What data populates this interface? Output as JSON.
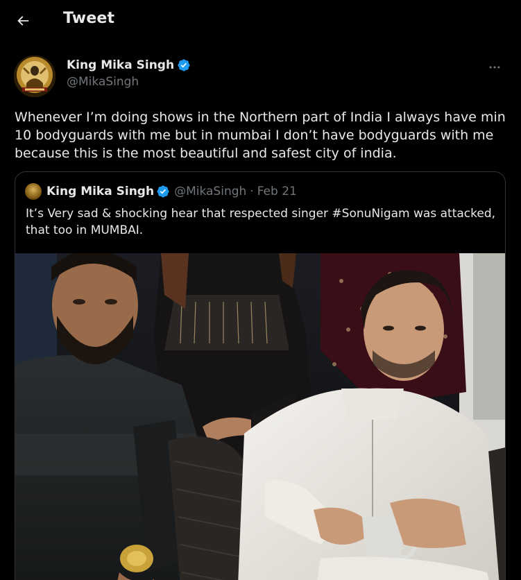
{
  "header": {
    "title": "Tweet",
    "back_icon": "arrow-left-icon"
  },
  "tweet": {
    "author": {
      "display_name": "King Mika Singh",
      "handle": "@MikaSingh",
      "verified": true,
      "verified_color": "#1d9bf0",
      "avatar_icon": "avatar-image"
    },
    "more_icon": "more-horizontal-icon",
    "text": "Whenever I’m doing shows in the Northern part of India I always have min 10 bodyguards with me but in mumbai I don’t have bodyguards with me because this is the most beautiful and safest city of india."
  },
  "quoted_tweet": {
    "author": {
      "display_name": "King Mika Singh",
      "handle": "@MikaSingh",
      "verified": true
    },
    "separator": "·",
    "date": "Feb 21",
    "text": "It’s Very sad & shocking hear that respected singer #SonuNigam was attacked, that too in MUMBAI.",
    "media_icon": "photo-image"
  },
  "colors": {
    "background": "#000000",
    "text_primary": "#e7e9ea",
    "text_secondary": "#71767b",
    "border": "#2f3336",
    "accent": "#1d9bf0"
  }
}
